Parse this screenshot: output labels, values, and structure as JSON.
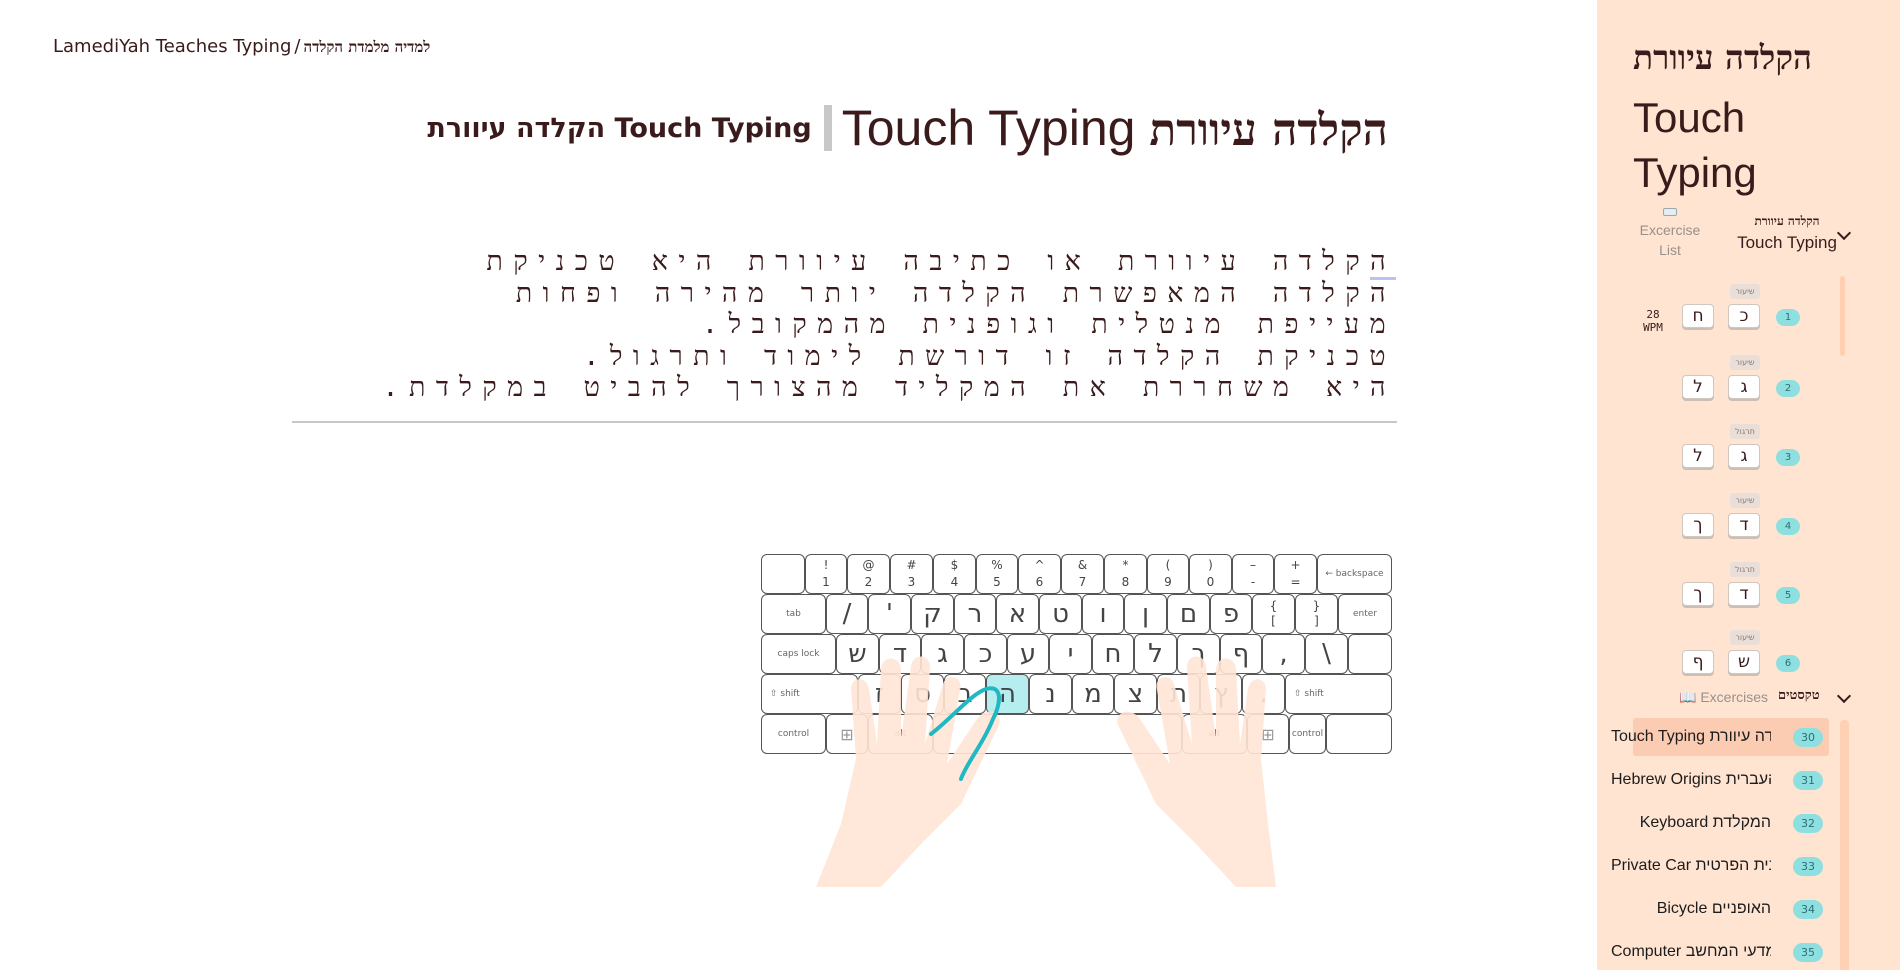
{
  "breadcrumb": {
    "site_en": "LamediYah Teaches Typing",
    "separator": "/",
    "site_he": "למדיה מלמדת הקלדה"
  },
  "page_title": {
    "small": "הקלדה עיוורת Touch Typing",
    "big_en": "Touch Typing",
    "big_he": "הקלדה עיוורת"
  },
  "lesson_text": {
    "lines": [
      {
        "first": "ה",
        "rest": "קלדה עיוורת או כתיבה עיוורת היא טכניקת"
      },
      {
        "first": "",
        "rest": "הקלדה המאפשרת הקלדה יותר מהירה ופחות"
      },
      {
        "first": "",
        "rest": "מעייפת מנטלית וגופנית מהמקובל."
      },
      {
        "first": "",
        "rest": "טכניקת הקלדה זו דורשת לימוד ותרגול."
      },
      {
        "first": "",
        "rest": "היא משחררת את המקליד מהצורך להביט במקלדת."
      }
    ]
  },
  "keyboard": {
    "number_row": [
      {
        "top": "",
        "bottom": ""
      },
      {
        "top": "!",
        "bottom": "1"
      },
      {
        "top": "@",
        "bottom": "2"
      },
      {
        "top": "#",
        "bottom": "3"
      },
      {
        "top": "$",
        "bottom": "4"
      },
      {
        "top": "%",
        "bottom": "5"
      },
      {
        "top": "^",
        "bottom": "6"
      },
      {
        "top": "&",
        "bottom": "7"
      },
      {
        "top": "*",
        "bottom": "8"
      },
      {
        "top": "(",
        "bottom": "9"
      },
      {
        "top": ")",
        "bottom": "0"
      },
      {
        "top": "–",
        "bottom": "-"
      },
      {
        "top": "+",
        "bottom": "="
      }
    ],
    "backspace": "← backspace",
    "tab": "tab",
    "top_row": [
      "/",
      "'",
      "ק",
      "ר",
      "א",
      "ט",
      "ו",
      "ן",
      "ם",
      "פ"
    ],
    "bracket_open": {
      "top": "{",
      "bottom": "["
    },
    "bracket_close": {
      "top": "}",
      "bottom": "]"
    },
    "enter": "enter",
    "caps": "caps lock",
    "home_row": [
      "ש",
      "ד",
      "ג",
      "כ",
      "ע",
      "י",
      "ח",
      "ל",
      "ך",
      "ף",
      ",",
      "\\"
    ],
    "shift": "⇧ shift",
    "bottom_row": [
      "ז",
      "ס",
      "ב",
      "ה",
      "נ",
      "מ",
      "צ",
      "ת",
      "ץ",
      "."
    ],
    "highlighted_key": "ה",
    "control": "control",
    "alt": "alt",
    "win_glyph": "⊞"
  },
  "sidebar": {
    "title_he": "הקלדה עיוורת",
    "title_en": "Touch Typing",
    "exercise_list": "Excercise List",
    "section_he": "הקלדה עיוורת",
    "section_en": "Touch Typing",
    "lessons": [
      {
        "tag": "שיעור",
        "keys": [
          "כ",
          "ח"
        ],
        "num": "1",
        "wpm_value": "28",
        "wpm_unit": "WPM"
      },
      {
        "tag": "שיעור",
        "keys": [
          "ג",
          "ל"
        ],
        "num": "2"
      },
      {
        "tag": "תרגול",
        "keys": [
          "ג",
          "ל"
        ],
        "num": "3"
      },
      {
        "tag": "שיעור",
        "keys": [
          "ד",
          "ך"
        ],
        "num": "4"
      },
      {
        "tag": "תרגול",
        "keys": [
          "ד",
          "ך"
        ],
        "num": "5"
      },
      {
        "tag": "שיעור",
        "keys": [
          "ש",
          "ף"
        ],
        "num": "6"
      }
    ],
    "texts_header": {
      "exercises": "📖 Excercises",
      "texts_he": "טקסטים"
    },
    "texts": [
      {
        "title": "Touch Typing הקלדה עיוורת",
        "num": "30",
        "active": true
      },
      {
        "title": "Hebrew Origins מקור העברית",
        "num": "31"
      },
      {
        "title": "Keyboard המקלדת",
        "num": "32"
      },
      {
        "title": "Private Car המכונית הפרטית",
        "num": "33"
      },
      {
        "title": "Bicycle האופניים",
        "num": "34"
      },
      {
        "title": "Computer מדעי המחשב",
        "num": "35"
      }
    ]
  },
  "colors": {
    "accent_teal": "#8ee0e0",
    "highlight_key": "#b6eef0",
    "sidebar_bg": "#ffe4d2",
    "hand": "#ffe6d6",
    "finger_path": "#1fb8c4"
  }
}
